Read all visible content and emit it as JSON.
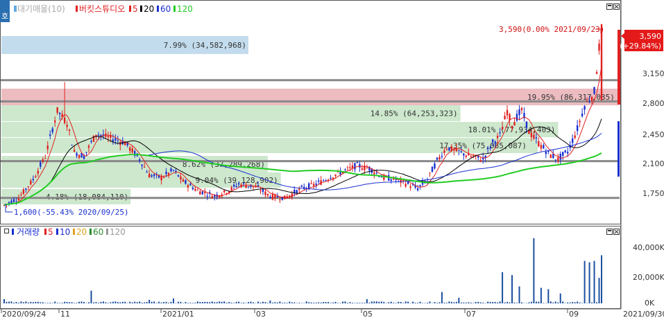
{
  "side_tab_label": "호",
  "price_legend": {
    "volume_profile_label": "대기매물(10)",
    "stock_name": "버킷스튜디오",
    "ma": [
      "5",
      "20",
      "60",
      "120"
    ],
    "ma_colors": [
      "#e02020",
      "#000000",
      "#1a2fd0",
      "#22cc22"
    ]
  },
  "volume_legend": {
    "label": "거래량",
    "ma": [
      "5",
      "10",
      "20",
      "60",
      "120"
    ],
    "ma_colors": [
      "#e02020",
      "#1a2fd0",
      "#e0a020",
      "#2a8a2a",
      "#999999"
    ]
  },
  "high_annotation": "3,590(0.00% 2021/09/23)",
  "low_annotation": "1,600(-55.43% 2020/09/25)",
  "current_price": {
    "value": "3,590",
    "change": "(+29.84%)"
  },
  "price_axis": [
    "3,150",
    "2,800",
    "2,450",
    "2,100",
    "1,750"
  ],
  "volume_axis": [
    "40,000K",
    "20,000K",
    "0K"
  ],
  "x_axis": [
    "2020/09/24",
    "11",
    "2021/01",
    "03",
    "05",
    "07",
    "09",
    "2021/09/30"
  ],
  "volume_profile": [
    {
      "label": "7.99% (34,582,968)",
      "value": 7.99
    },
    {
      "label": "19.95% (86,317,035)",
      "value": 19.95
    },
    {
      "label": "14.85% (64,253,323)",
      "value": 14.85
    },
    {
      "label": "18.01% (77,934,403)",
      "value": 18.01
    },
    {
      "label": "17.35% (75,085,087)",
      "value": 17.35
    },
    {
      "label": "8.62% (37,289,268)",
      "value": 8.62
    },
    {
      "label": "9.04% (39,128,902)",
      "value": 9.04
    },
    {
      "label": "4.18% (18,084,110)",
      "value": 4.18
    }
  ],
  "chart_data": {
    "type": "candlestick",
    "price_range": [
      1600,
      3590
    ],
    "volume_range_k": [
      0,
      45000
    ],
    "support_resistance_levels": [
      2980,
      2750,
      2100,
      1700
    ],
    "high": {
      "price": 3590,
      "date": "2021/09/23"
    },
    "low": {
      "price": 1600,
      "date": "2020/09/25"
    },
    "last_close": 3590,
    "change_pct": 29.84
  }
}
